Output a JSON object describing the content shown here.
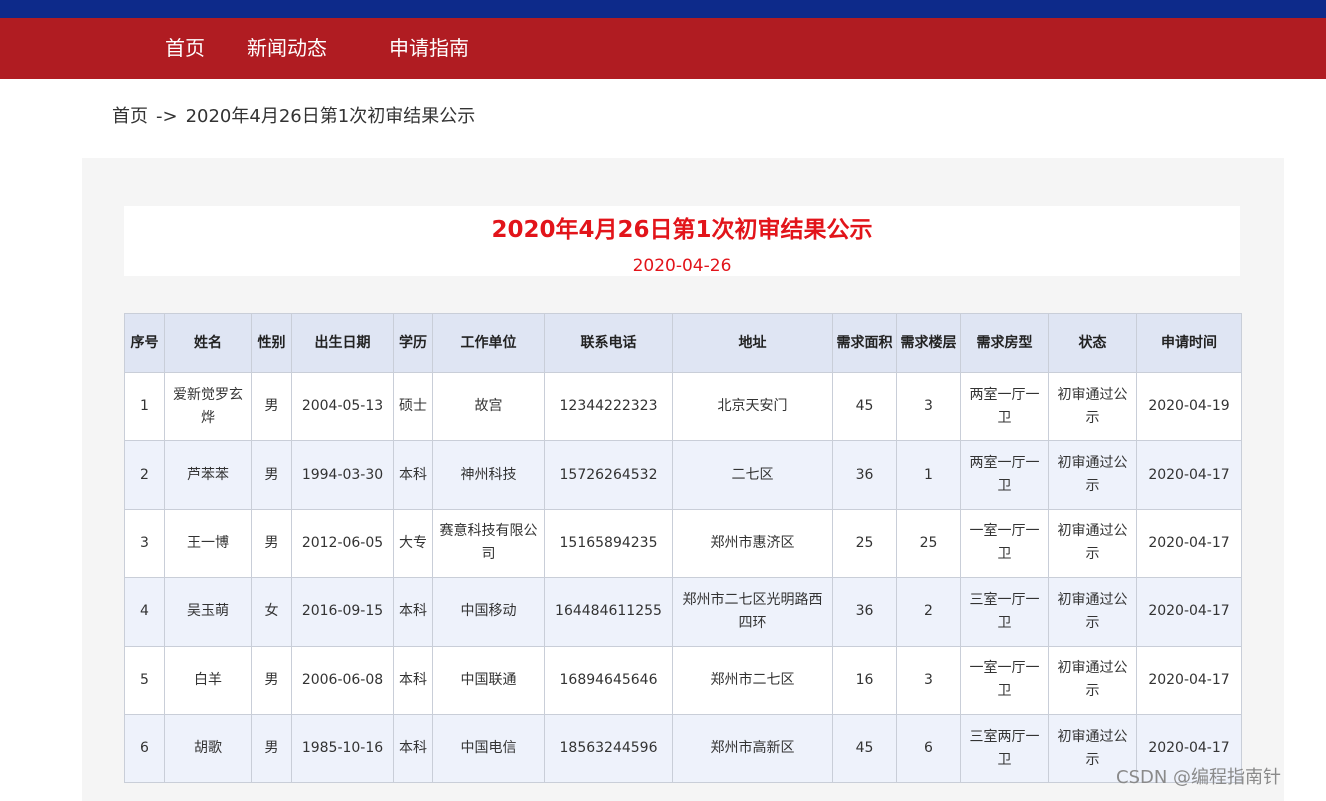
{
  "nav": {
    "items": [
      {
        "label": "首页"
      },
      {
        "label": "新闻动态"
      },
      {
        "label": "申请指南"
      }
    ]
  },
  "breadcrumb": {
    "home": "首页",
    "separator": "->",
    "current": "2020年4月26日第1次初审结果公示"
  },
  "article": {
    "title": "2020年4月26日第1次初审结果公示",
    "date": "2020-04-26"
  },
  "table": {
    "headers": [
      "序号",
      "姓名",
      "性别",
      "出生日期",
      "学历",
      "工作单位",
      "联系电话",
      "地址",
      "需求面积",
      "需求楼层",
      "需求房型",
      "状态",
      "申请时间"
    ],
    "rows": [
      {
        "cells": [
          "1",
          "爱新觉罗玄烨",
          "男",
          "2004-05-13",
          "硕士",
          "故宫",
          "12344222323",
          "北京天安门",
          "45",
          "3",
          "两室一厅一卫",
          "初审通过公示",
          "2020-04-19"
        ]
      },
      {
        "cells": [
          "2",
          "芦苯苯",
          "男",
          "1994-03-30",
          "本科",
          "神州科技",
          "15726264532",
          "二七区",
          "36",
          "1",
          "两室一厅一卫",
          "初审通过公示",
          "2020-04-17"
        ]
      },
      {
        "cells": [
          "3",
          "王一博",
          "男",
          "2012-06-05",
          "大专",
          "赛意科技有限公司",
          "15165894235",
          "郑州市惠济区",
          "25",
          "25",
          "一室一厅一卫",
          "初审通过公示",
          "2020-04-17"
        ]
      },
      {
        "cells": [
          "4",
          "吴玉萌",
          "女",
          "2016-09-15",
          "本科",
          "中国移动",
          "164484611255",
          "郑州市二七区光明路西四环",
          "36",
          "2",
          "三室一厅一卫",
          "初审通过公示",
          "2020-04-17"
        ]
      },
      {
        "cells": [
          "5",
          "白羊",
          "男",
          "2006-06-08",
          "本科",
          "中国联通",
          "16894645646",
          "郑州市二七区",
          "16",
          "3",
          "一室一厅一卫",
          "初审通过公示",
          "2020-04-17"
        ]
      },
      {
        "cells": [
          "6",
          "胡歌",
          "男",
          "1985-10-16",
          "本科",
          "中国电信",
          "18563244596",
          "郑州市高新区",
          "45",
          "6",
          "三室两厅一卫",
          "初审通过公示",
          "2020-04-17"
        ]
      }
    ]
  },
  "watermark": "CSDN @编程指南针",
  "colors": {
    "top_strip": "#0d2a8a",
    "nav_background": "#b01c22",
    "title": "#e2141a",
    "header_row": "#dfe5f3",
    "alt_row": "#eef2fb"
  }
}
